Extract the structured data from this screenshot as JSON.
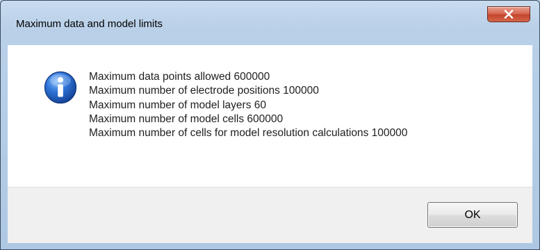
{
  "dialog": {
    "title": "Maximum data and model limits",
    "close_icon": "close-icon",
    "message_icon": "info-icon",
    "messages": [
      "Maximum data points allowed 600000",
      "Maximum number of electrode positions 100000",
      "Maximum number of model layers 60",
      "Maximum number of model cells 600000",
      "Maximum number of cells for model resolution calculations 100000"
    ],
    "ok_label": "OK"
  },
  "colors": {
    "close_button": "#c3452c",
    "info_icon": "#1f5fc4",
    "frame": "#b9d0e8"
  }
}
